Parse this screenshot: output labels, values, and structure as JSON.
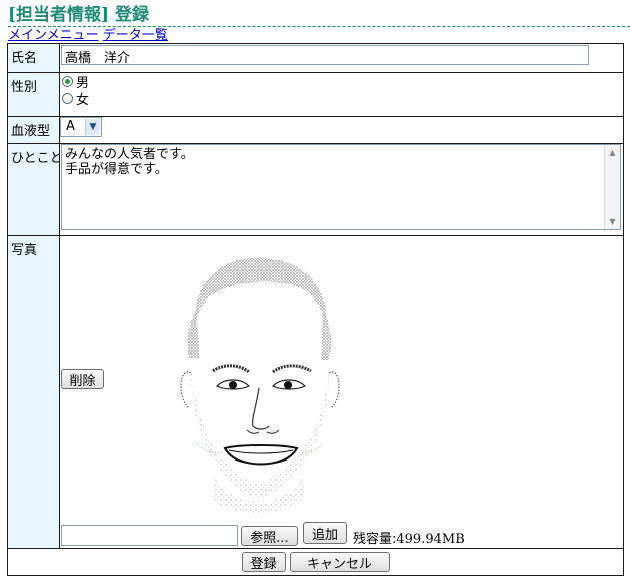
{
  "page": {
    "title": "[担当者情報] 登録"
  },
  "nav": {
    "main_menu": "メインメニュー",
    "data_list": "データ一覧"
  },
  "form": {
    "name": {
      "label": "氏名",
      "value": "高橋　洋介"
    },
    "gender": {
      "label": "性別",
      "options": [
        "男",
        "女"
      ],
      "selected": "男"
    },
    "blood_type": {
      "label": "血液型",
      "value": "A"
    },
    "comment": {
      "label": "ひとこと",
      "line1": "みんなの人気者です。",
      "line2": "手品が得意です。"
    },
    "photo": {
      "label": "写真",
      "delete_label": "削除",
      "browse_label": "参照...",
      "add_label": "追加",
      "remaining_label": "残容量:",
      "remaining_value": "499.94MB"
    }
  },
  "actions": {
    "submit_label": "登録",
    "cancel_label": "キャンセル"
  },
  "colors": {
    "title": "#1f8a78",
    "label_bg": "#e9f5ff",
    "link": "#0000cc"
  }
}
